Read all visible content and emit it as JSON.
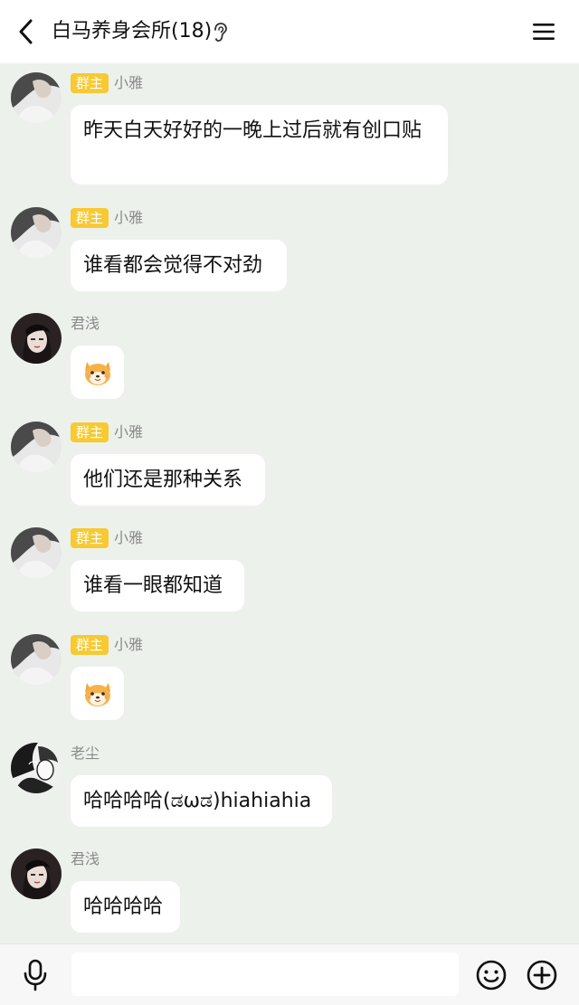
{
  "header": {
    "back_icon": "chevron-left-icon",
    "title": "白马养身会所(18)",
    "ear_icon": "ear-icon",
    "menu_icon": "hamburger-menu-icon"
  },
  "colors": {
    "background": "#edf1ec",
    "header_bg": "#ffffff",
    "bubble_bg": "#ffffff",
    "owner_badge": "#f7c933",
    "sender_name": "#8a8a8a"
  },
  "messages": [
    {
      "sender": "小雅",
      "badge": "群主",
      "avatar": "xiaoya-avatar",
      "type": "text",
      "text": "昨天白天好好的一晚上过后就有创口贴"
    },
    {
      "sender": "小雅",
      "badge": "群主",
      "avatar": "xiaoya-avatar",
      "type": "text",
      "text": "谁看都会觉得不对劲"
    },
    {
      "sender": "君浅",
      "badge": "",
      "avatar": "junqian-avatar",
      "type": "sticker",
      "sticker": "shiba-dog-sticker"
    },
    {
      "sender": "小雅",
      "badge": "群主",
      "avatar": "xiaoya-avatar",
      "type": "text",
      "text": "他们还是那种关系"
    },
    {
      "sender": "小雅",
      "badge": "群主",
      "avatar": "xiaoya-avatar",
      "type": "text",
      "text": "谁看一眼都知道"
    },
    {
      "sender": "小雅",
      "badge": "群主",
      "avatar": "xiaoya-avatar",
      "type": "sticker",
      "sticker": "shiba-dog-sticker"
    },
    {
      "sender": "老尘",
      "badge": "",
      "avatar": "laochen-avatar",
      "type": "text",
      "text": "哈哈哈哈(ಡωಡ)hiahiahia"
    },
    {
      "sender": "君浅",
      "badge": "",
      "avatar": "junqian-avatar",
      "type": "text",
      "text": "哈哈哈哈"
    }
  ],
  "footer": {
    "mic_icon": "microphone-icon",
    "input_value": "",
    "emoji_icon": "smiley-icon",
    "plus_icon": "plus-circle-icon"
  }
}
